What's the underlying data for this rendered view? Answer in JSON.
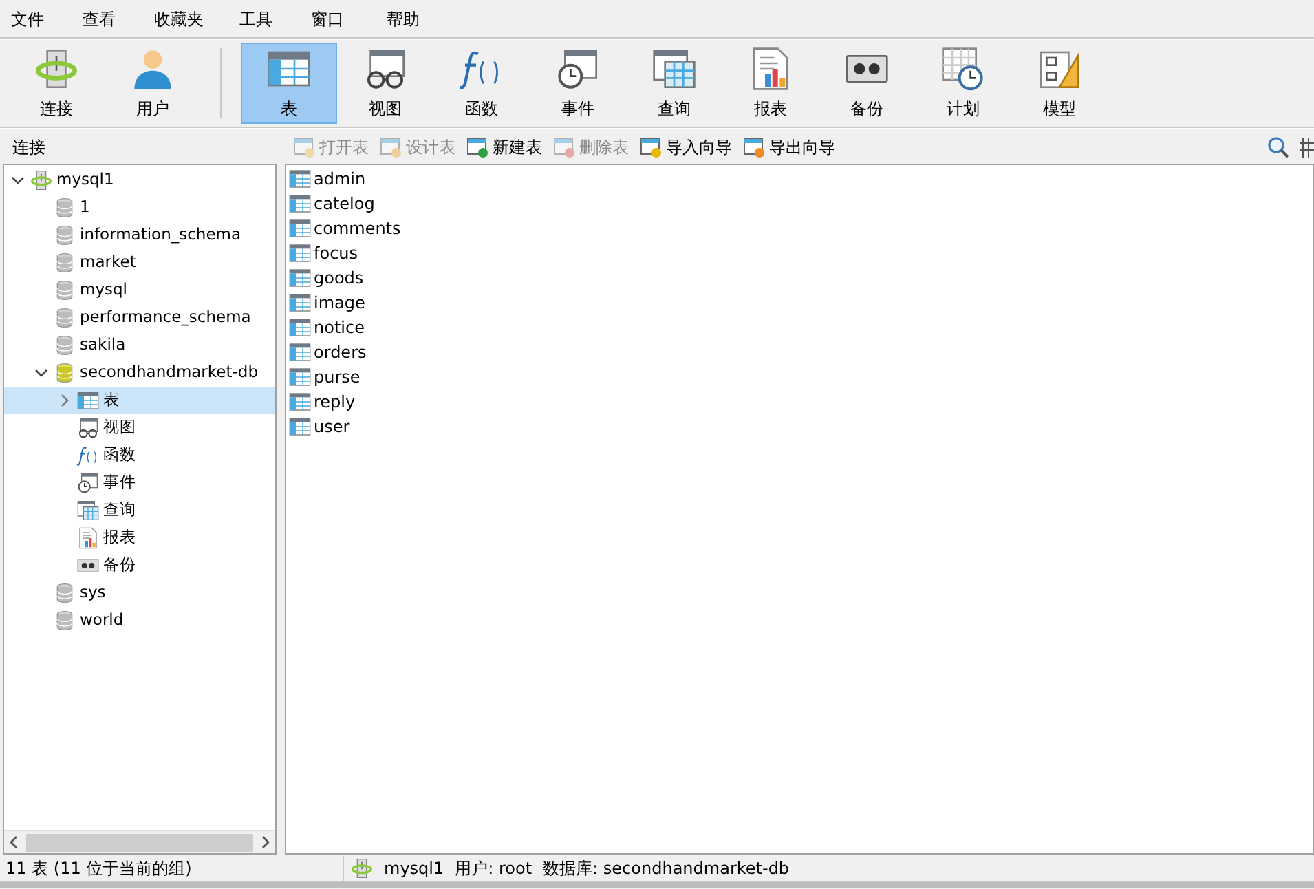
{
  "menu": [
    "文件",
    "查看",
    "收藏夹",
    "工具",
    "窗口",
    "帮助"
  ],
  "toolbar": [
    {
      "label": "连接",
      "kind": "connection",
      "selected": false
    },
    {
      "label": "用户",
      "kind": "user",
      "selected": false
    },
    {
      "label": "表",
      "kind": "table",
      "selected": true
    },
    {
      "label": "视图",
      "kind": "view",
      "selected": false
    },
    {
      "label": "函数",
      "kind": "function",
      "selected": false
    },
    {
      "label": "事件",
      "kind": "event",
      "selected": false
    },
    {
      "label": "查询",
      "kind": "query",
      "selected": false
    },
    {
      "label": "报表",
      "kind": "report",
      "selected": false
    },
    {
      "label": "备份",
      "kind": "backup",
      "selected": false
    },
    {
      "label": "计划",
      "kind": "schedule",
      "selected": false
    },
    {
      "label": "模型",
      "kind": "model",
      "selected": false
    }
  ],
  "sidebar": {
    "title": "连接",
    "tree": [
      {
        "label": "mysql1",
        "kind": "connection",
        "expanded": true,
        "selected": false,
        "children": [
          {
            "label": "1",
            "kind": "database",
            "expanded": false,
            "selected": false
          },
          {
            "label": "information_schema",
            "kind": "database",
            "expanded": false,
            "selected": false
          },
          {
            "label": "market",
            "kind": "database",
            "expanded": false,
            "selected": false
          },
          {
            "label": "mysql",
            "kind": "database",
            "expanded": false,
            "selected": false
          },
          {
            "label": "performance_schema",
            "kind": "database",
            "expanded": false,
            "selected": false
          },
          {
            "label": "sakila",
            "kind": "database",
            "expanded": false,
            "selected": false
          },
          {
            "label": "secondhandmarket-db",
            "kind": "database",
            "expanded": true,
            "selected": false,
            "children": [
              {
                "label": "表",
                "kind": "table",
                "expanded": false,
                "selected": true
              },
              {
                "label": "视图",
                "kind": "view",
                "selected": false
              },
              {
                "label": "函数",
                "kind": "function",
                "selected": false
              },
              {
                "label": "事件",
                "kind": "event",
                "selected": false
              },
              {
                "label": "查询",
                "kind": "query",
                "selected": false
              },
              {
                "label": "报表",
                "kind": "report",
                "selected": false
              },
              {
                "label": "备份",
                "kind": "backup",
                "selected": false
              }
            ]
          },
          {
            "label": "sys",
            "kind": "database",
            "expanded": false,
            "selected": false
          },
          {
            "label": "world",
            "kind": "database",
            "expanded": false,
            "selected": false
          }
        ]
      }
    ]
  },
  "actions": [
    {
      "label": "打开表",
      "kind": "open",
      "disabled": true
    },
    {
      "label": "设计表",
      "kind": "design",
      "disabled": true
    },
    {
      "label": "新建表",
      "kind": "new",
      "disabled": false
    },
    {
      "label": "删除表",
      "kind": "delete",
      "disabled": true
    },
    {
      "label": "导入向导",
      "kind": "import",
      "disabled": false
    },
    {
      "label": "导出向导",
      "kind": "export",
      "disabled": false
    }
  ],
  "tables": [
    "admin",
    "catelog",
    "comments",
    "focus",
    "goods",
    "image",
    "notice",
    "orders",
    "purse",
    "reply",
    "user"
  ],
  "status_bar": {
    "count": "11 表 (11 位于当前的组)",
    "connection": "mysql1",
    "user": "用户: root",
    "database": "数据库: secondhandmarket-db"
  }
}
